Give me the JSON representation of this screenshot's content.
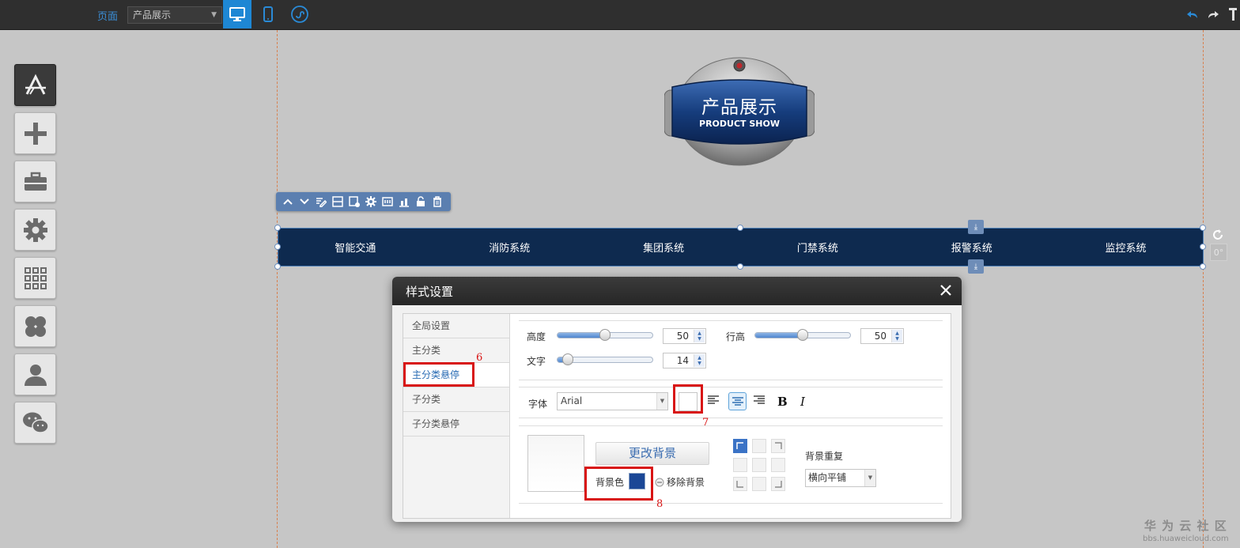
{
  "topbar": {
    "page_label": "页面",
    "page_select": "产品展示",
    "accent": "#1e87d4"
  },
  "left_toolbar": {
    "items": [
      "app-store-icon",
      "plus-icon",
      "toolbox-icon",
      "gear-icon",
      "grid-icon",
      "clover-icon",
      "user-icon",
      "wechat-icon"
    ]
  },
  "logo": {
    "title": "产品展示",
    "subtitle": "PRODUCT SHOW"
  },
  "navbar": {
    "items": [
      "智能交通",
      "消防系统",
      "集团系统",
      "门禁系统",
      "报警系统",
      "监控系统"
    ],
    "background": "#0e2a4f"
  },
  "angle": "0°",
  "dialog": {
    "title": "样式设置",
    "menu": [
      "全局设置",
      "主分类",
      "主分类悬停",
      "子分类",
      "子分类悬停"
    ],
    "selected_menu": "主分类悬停",
    "height_label": "高度",
    "height_value": "50",
    "line_height_label": "行高",
    "line_height_value": "50",
    "text_label": "文字",
    "text_value": "14",
    "font_label": "字体",
    "font_value": "Arial",
    "bold": "B",
    "italic": "I",
    "change_bg": "更改背景",
    "bg_color_label": "背景色",
    "bg_color": "#1b4796",
    "remove_bg": "移除背景",
    "bg_repeat_label": "背景重复",
    "bg_repeat_value": "横向平铺"
  },
  "annotations": [
    "6",
    "7",
    "8"
  ],
  "watermark": {
    "title": "华 为 云 社 区",
    "url": "bbs.huaweicloud.com"
  }
}
